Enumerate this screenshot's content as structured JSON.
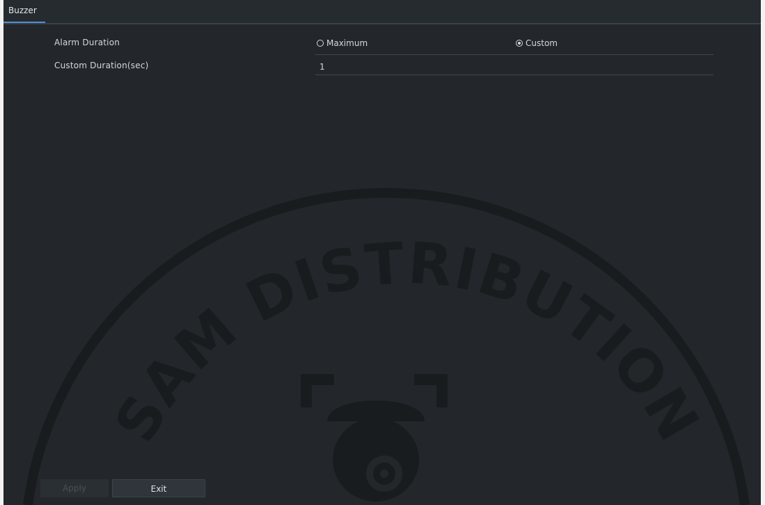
{
  "tabbar": {
    "active_tab": "Buzzer"
  },
  "form": {
    "alarm_duration_label": "Alarm Duration",
    "option_maximum": "Maximum",
    "option_custom": "Custom",
    "selected_option": "Custom",
    "custom_duration_label": "Custom Duration(sec)",
    "custom_duration_value": "1"
  },
  "footer": {
    "apply_label": "Apply",
    "exit_label": "Exit"
  },
  "watermark": {
    "text": "SAM DISTRIBUTION"
  },
  "colors": {
    "background": "#23272b",
    "tab_underline": "#4f8fd6",
    "frame": "#f2f2f2"
  }
}
